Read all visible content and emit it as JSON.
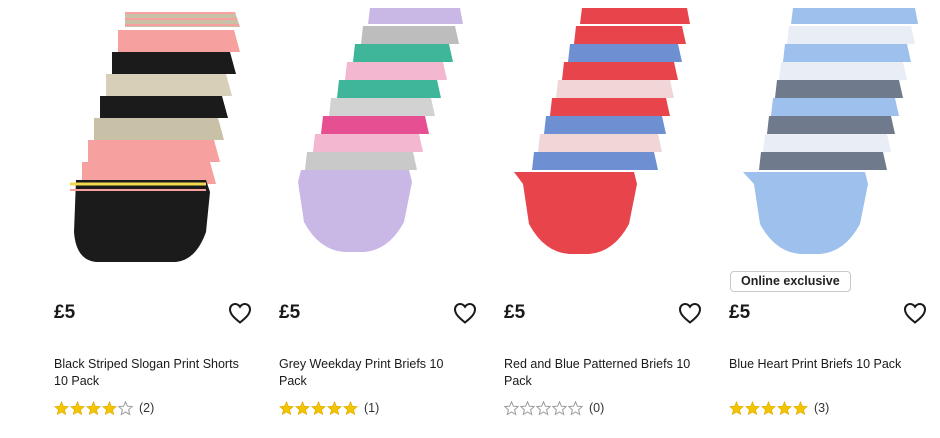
{
  "products": [
    {
      "price": "£5",
      "title": "Black Striped Slogan Print Shorts 10 Pack",
      "rating": 4,
      "review_count": "(2)",
      "image_icon": "black-striped-shorts-stack-image",
      "colors": [
        "#1b1b1b",
        "#f6a0a0",
        "#c9c0a8"
      ]
    },
    {
      "price": "£5",
      "title": "Grey Weekday Print Briefs 10 Pack",
      "rating": 5,
      "review_count": "(1)",
      "image_icon": "grey-weekday-briefs-stack-image",
      "colors": [
        "#c9b8e6",
        "#f3b7cf",
        "#3fb59a"
      ]
    },
    {
      "price": "£5",
      "title": "Red and Blue Patterned Briefs 10 Pack",
      "rating": 0,
      "review_count": "(0)",
      "image_icon": "red-blue-briefs-stack-image",
      "colors": [
        "#e8444c",
        "#6e8fd1",
        "#f1d6d8"
      ]
    },
    {
      "price": "£5",
      "title": "Blue Heart Print Briefs 10 Pack",
      "rating": 5,
      "review_count": "(3)",
      "badge": "Online exclusive",
      "image_icon": "blue-heart-briefs-stack-image",
      "colors": [
        "#9ec0ec",
        "#e9eef6",
        "#6f7b8c"
      ]
    }
  ],
  "colors": {
    "star_filled": "#f5c400",
    "star_empty_stroke": "#9a9a9a",
    "text": "#1a1a1a"
  },
  "icons": {
    "wishlist": "heart-outline-icon",
    "star": "star-icon"
  }
}
